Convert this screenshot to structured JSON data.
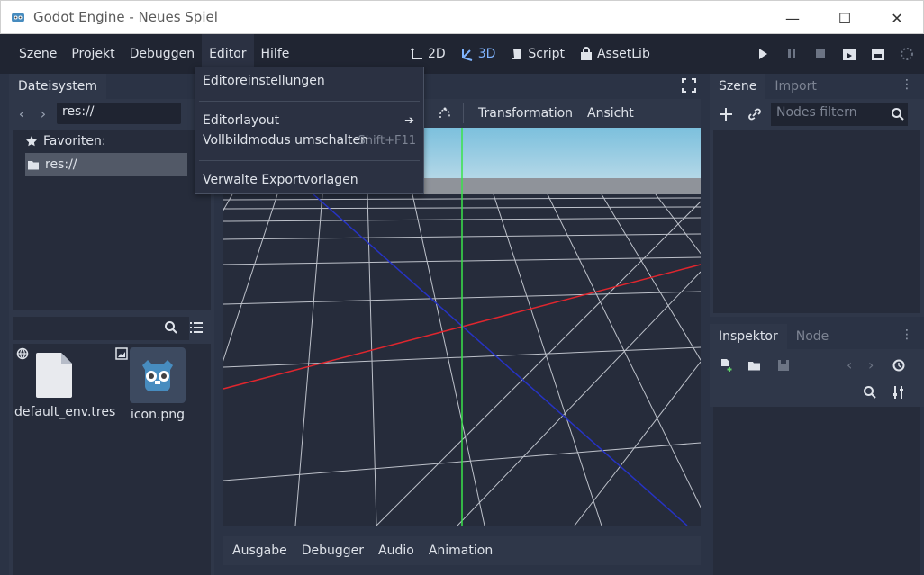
{
  "window": {
    "title": "Godot Engine - Neues Spiel",
    "minimize": "—",
    "maximize": "☐",
    "close": "✕"
  },
  "menubar": {
    "menus": [
      "Szene",
      "Projekt",
      "Debuggen",
      "Editor",
      "Hilfe"
    ],
    "modes": [
      {
        "label": "2D",
        "icon": "2d-mode-icon"
      },
      {
        "label": "3D",
        "icon": "3d-mode-icon"
      },
      {
        "label": "Script",
        "icon": "script-icon"
      },
      {
        "label": "AssetLib",
        "icon": "assetlib-icon"
      }
    ],
    "active_mode": "3D",
    "accent_color": "#7fb4ff"
  },
  "editor_menu": {
    "items": [
      {
        "label": "Editoreinstellungen"
      },
      {
        "label": "Editorlayout",
        "submenu": true
      },
      {
        "label": "Vollbildmodus umschalten",
        "shortcut": "Shift+F11"
      },
      {
        "label": "Verwalte Exportvorlagen"
      }
    ]
  },
  "filesystem": {
    "tab": "Dateisystem",
    "path": "res://",
    "tree": [
      {
        "label": "Favoriten:",
        "icon": "star-icon"
      },
      {
        "label": "res://",
        "icon": "folder-icon"
      }
    ],
    "files": [
      {
        "name": "default_env.tres",
        "icon": "file-icon"
      },
      {
        "name": "icon.png",
        "icon": "godot-icon"
      }
    ]
  },
  "viewport": {
    "menus": [
      "Transformation",
      "Ansicht"
    ]
  },
  "bottom_tabs": [
    "Ausgabe",
    "Debugger",
    "Audio",
    "Animation"
  ],
  "scene_dock": {
    "tabs": [
      "Szene",
      "Import"
    ],
    "filter_placeholder": "Nodes filtern"
  },
  "inspector": {
    "tabs": [
      "Inspektor",
      "Node"
    ]
  }
}
